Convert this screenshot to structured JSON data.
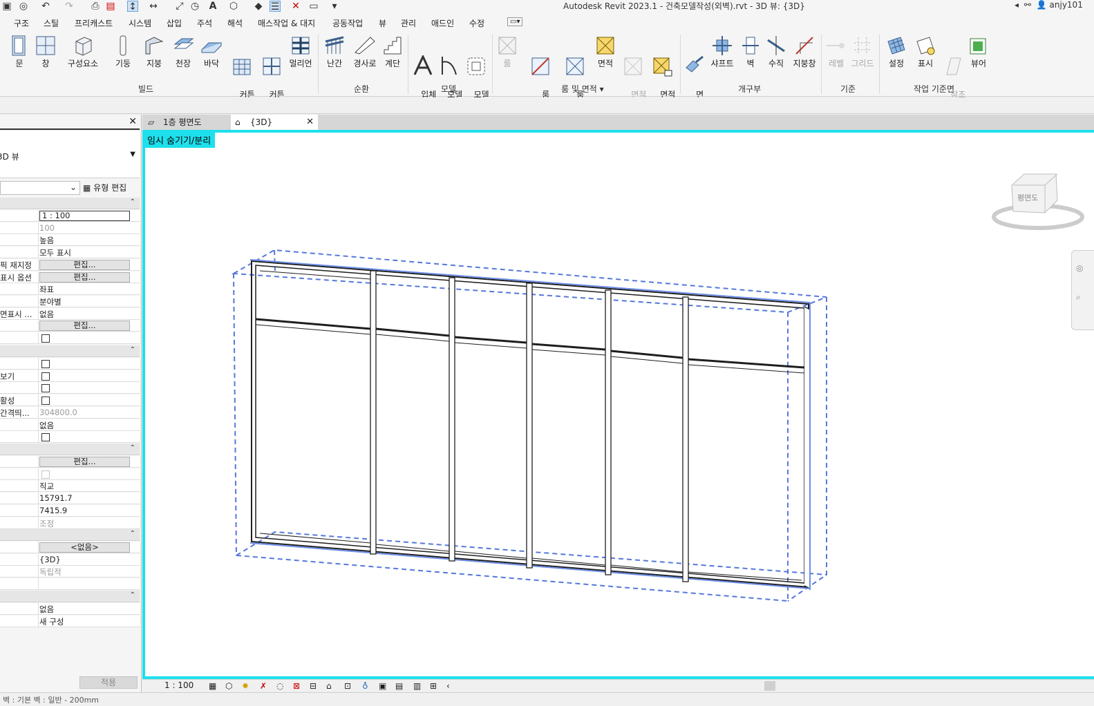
{
  "app": {
    "title": "Autodesk Revit 2023.1 - 건축모델작성(외벽).rvt - 3D 뷰: {3D}",
    "user": "anjy101"
  },
  "ribbon_tabs": [
    "구조",
    "스틸",
    "프리캐스트",
    "시스템",
    "삽입",
    "주석",
    "해석",
    "매스작업 & 대지",
    "공동작업",
    "뷰",
    "관리",
    "애드인",
    "수정"
  ],
  "ribbon": {
    "build": {
      "label": "빌드",
      "buttons": [
        "문",
        "창",
        "구성요소",
        "기둥",
        "지붕",
        "천장",
        "바닥",
        "커튼\n시스템",
        "커튼\n그리드",
        "멀리언"
      ]
    },
    "circulation": {
      "label": "순환",
      "buttons": [
        "난간",
        "경사로",
        "계단"
      ]
    },
    "model": {
      "label": "모델",
      "buttons": [
        "입체\n문자",
        "모델\n선",
        "모델\n그룹"
      ]
    },
    "room_area": {
      "label": "룸 및 면적",
      "buttons": [
        "룸",
        "룸\n구분 기호",
        "룸\n태그",
        "면적",
        "면적\n경계",
        "면적\n태그"
      ]
    },
    "opening": {
      "label": "개구부",
      "buttons": [
        "면\n별",
        "샤프트",
        "벽",
        "수직",
        "지붕창"
      ]
    },
    "datum": {
      "label": "기준",
      "buttons": [
        "레벨",
        "그리드"
      ]
    },
    "workplane": {
      "label": "작업 기준면",
      "buttons": [
        "설정",
        "표시",
        "참조\n평면",
        "뷰어"
      ]
    }
  },
  "properties": {
    "type_name": "3D 뷰",
    "edit_type": "유형 편집",
    "rows": [
      {
        "label": "",
        "value": "1 : 100",
        "kind": "input"
      },
      {
        "label": "",
        "value": "100",
        "kind": "gray"
      },
      {
        "label": "",
        "value": "높음",
        "kind": "text"
      },
      {
        "label": "",
        "value": "모두 표시",
        "kind": "text"
      },
      {
        "label": "픽 재지정",
        "value": "편집...",
        "kind": "button"
      },
      {
        "label": "표시 옵션",
        "value": "편집...",
        "kind": "button"
      },
      {
        "label": "",
        "value": "좌표",
        "kind": "text"
      },
      {
        "label": "",
        "value": "분야별",
        "kind": "text"
      },
      {
        "label": "면표시 ...",
        "value": "없음",
        "kind": "text"
      },
      {
        "label": "",
        "value": "편집...",
        "kind": "button"
      },
      {
        "label": "",
        "value": "",
        "kind": "check"
      }
    ],
    "rows2": [
      {
        "label": "",
        "value": "",
        "kind": "check"
      },
      {
        "label": "보기",
        "value": "",
        "kind": "check"
      },
      {
        "label": "",
        "value": "",
        "kind": "check"
      },
      {
        "label": "활성",
        "value": "",
        "kind": "check"
      },
      {
        "label": "간격띄...",
        "value": "304800.0",
        "kind": "gray"
      },
      {
        "label": "",
        "value": "없음",
        "kind": "text"
      },
      {
        "label": "",
        "value": "",
        "kind": "check"
      }
    ],
    "rows3": [
      {
        "label": "",
        "value": "편집...",
        "kind": "button"
      },
      {
        "label": "",
        "value": "",
        "kind": "checkdis"
      },
      {
        "label": "",
        "value": "직교",
        "kind": "text"
      },
      {
        "label": "",
        "value": "15791.7",
        "kind": "text"
      },
      {
        "label": "",
        "value": "7415.9",
        "kind": "text"
      },
      {
        "label": "",
        "value": "조정",
        "kind": "gray"
      }
    ],
    "rows4": [
      {
        "label": "",
        "value": "<없음>",
        "kind": "button"
      },
      {
        "label": "",
        "value": "{3D}",
        "kind": "text"
      },
      {
        "label": "",
        "value": "독립적",
        "kind": "gray"
      },
      {
        "label": "",
        "value": "",
        "kind": "text"
      }
    ],
    "rows5": [
      {
        "label": "",
        "value": "없음",
        "kind": "text"
      },
      {
        "label": "",
        "value": "새 구성",
        "kind": "text"
      }
    ],
    "apply": "적용"
  },
  "view_tabs": [
    {
      "label": "1층 평면도"
    },
    {
      "label": "{3D}"
    }
  ],
  "viewport": {
    "temp_label": "임시 숨기기/분리",
    "viewcube_face": "평면도"
  },
  "view_control": {
    "scale": "1 : 100"
  },
  "status": {
    "text": "벽 : 기본 벽 : 일반 - 200mm"
  }
}
